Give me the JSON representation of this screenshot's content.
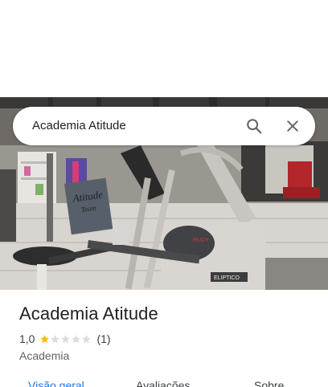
{
  "search": {
    "query": "Academia Atitude"
  },
  "photo": {
    "sign_text": "Atitude Team",
    "machine_brand": "RUDY",
    "machine_label": "ELIPTICO"
  },
  "place": {
    "title": "Academia Atitude",
    "rating": "1,0",
    "rating_stars": 1,
    "review_count": "(1)",
    "category": "Academia"
  },
  "tabs": [
    {
      "label": "Visão geral",
      "active": true
    },
    {
      "label": "Avaliações",
      "active": false
    },
    {
      "label": "Sobre",
      "active": false
    }
  ],
  "colors": {
    "accent": "#1a73e8",
    "star_filled": "#fbbc04",
    "star_empty": "#dadce0"
  },
  "icons": {
    "search": "search-icon",
    "close": "close-icon"
  }
}
